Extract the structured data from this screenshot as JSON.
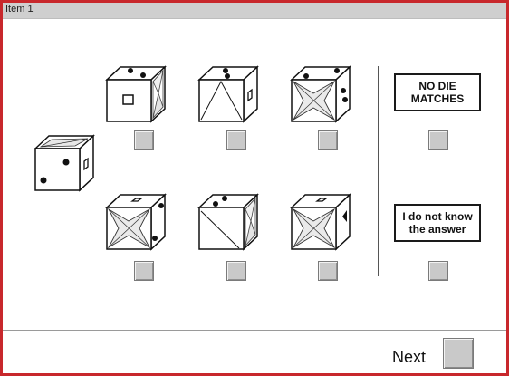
{
  "title": "Item 1",
  "options": {
    "no_die_matches": "NO DIE\nMATCHES",
    "do_not_know": "I do not know\nthe answer"
  },
  "footer": {
    "next_label": "Next"
  },
  "colors": {
    "frame": "#c8282c",
    "titlebar": "#cfcfcf",
    "checkbox": "#c9c9c9"
  },
  "die_choices": [
    "die-a",
    "die-b",
    "die-c",
    "die-d",
    "die-e",
    "die-f"
  ]
}
